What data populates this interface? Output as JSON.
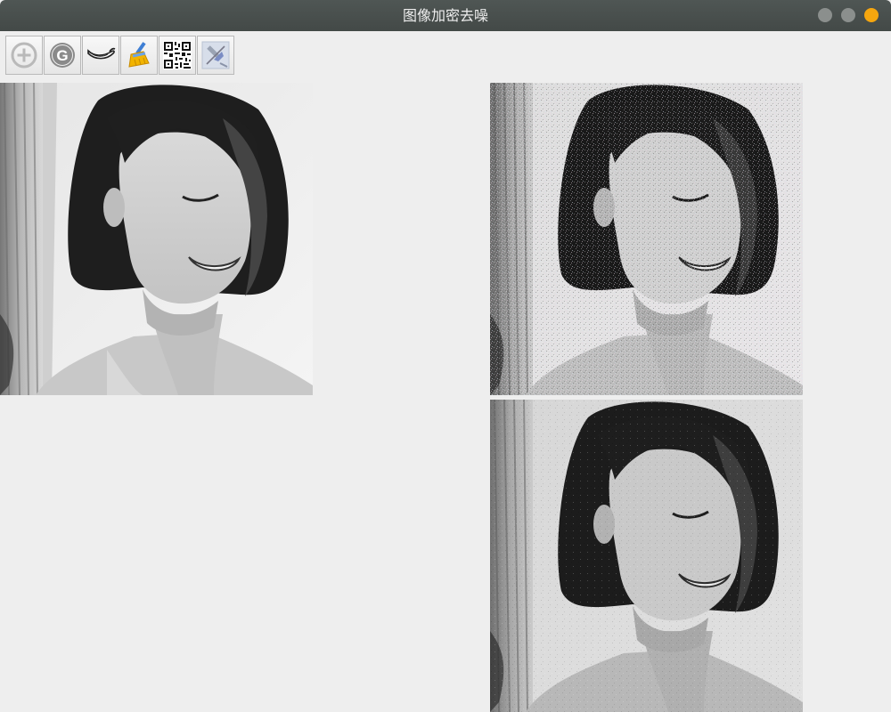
{
  "window": {
    "title": "图像加密去噪",
    "controls": [
      "minimize",
      "maximize",
      "close"
    ],
    "close_color": "#f6a60f"
  },
  "toolbar": {
    "tools": [
      {
        "icon": "plus-circle-icon"
      },
      {
        "icon": "g-circle-icon"
      },
      {
        "icon": "pepper-icon"
      },
      {
        "icon": "broom-icon"
      },
      {
        "icon": "qr-code-icon"
      },
      {
        "icon": "pin-icon"
      }
    ]
  },
  "images": [
    {
      "role": "original",
      "style": "grayscale portrait"
    },
    {
      "role": "encrypted",
      "style": "grayscale portrait with noise"
    },
    {
      "role": "denoised",
      "style": "grayscale portrait restored"
    }
  ]
}
